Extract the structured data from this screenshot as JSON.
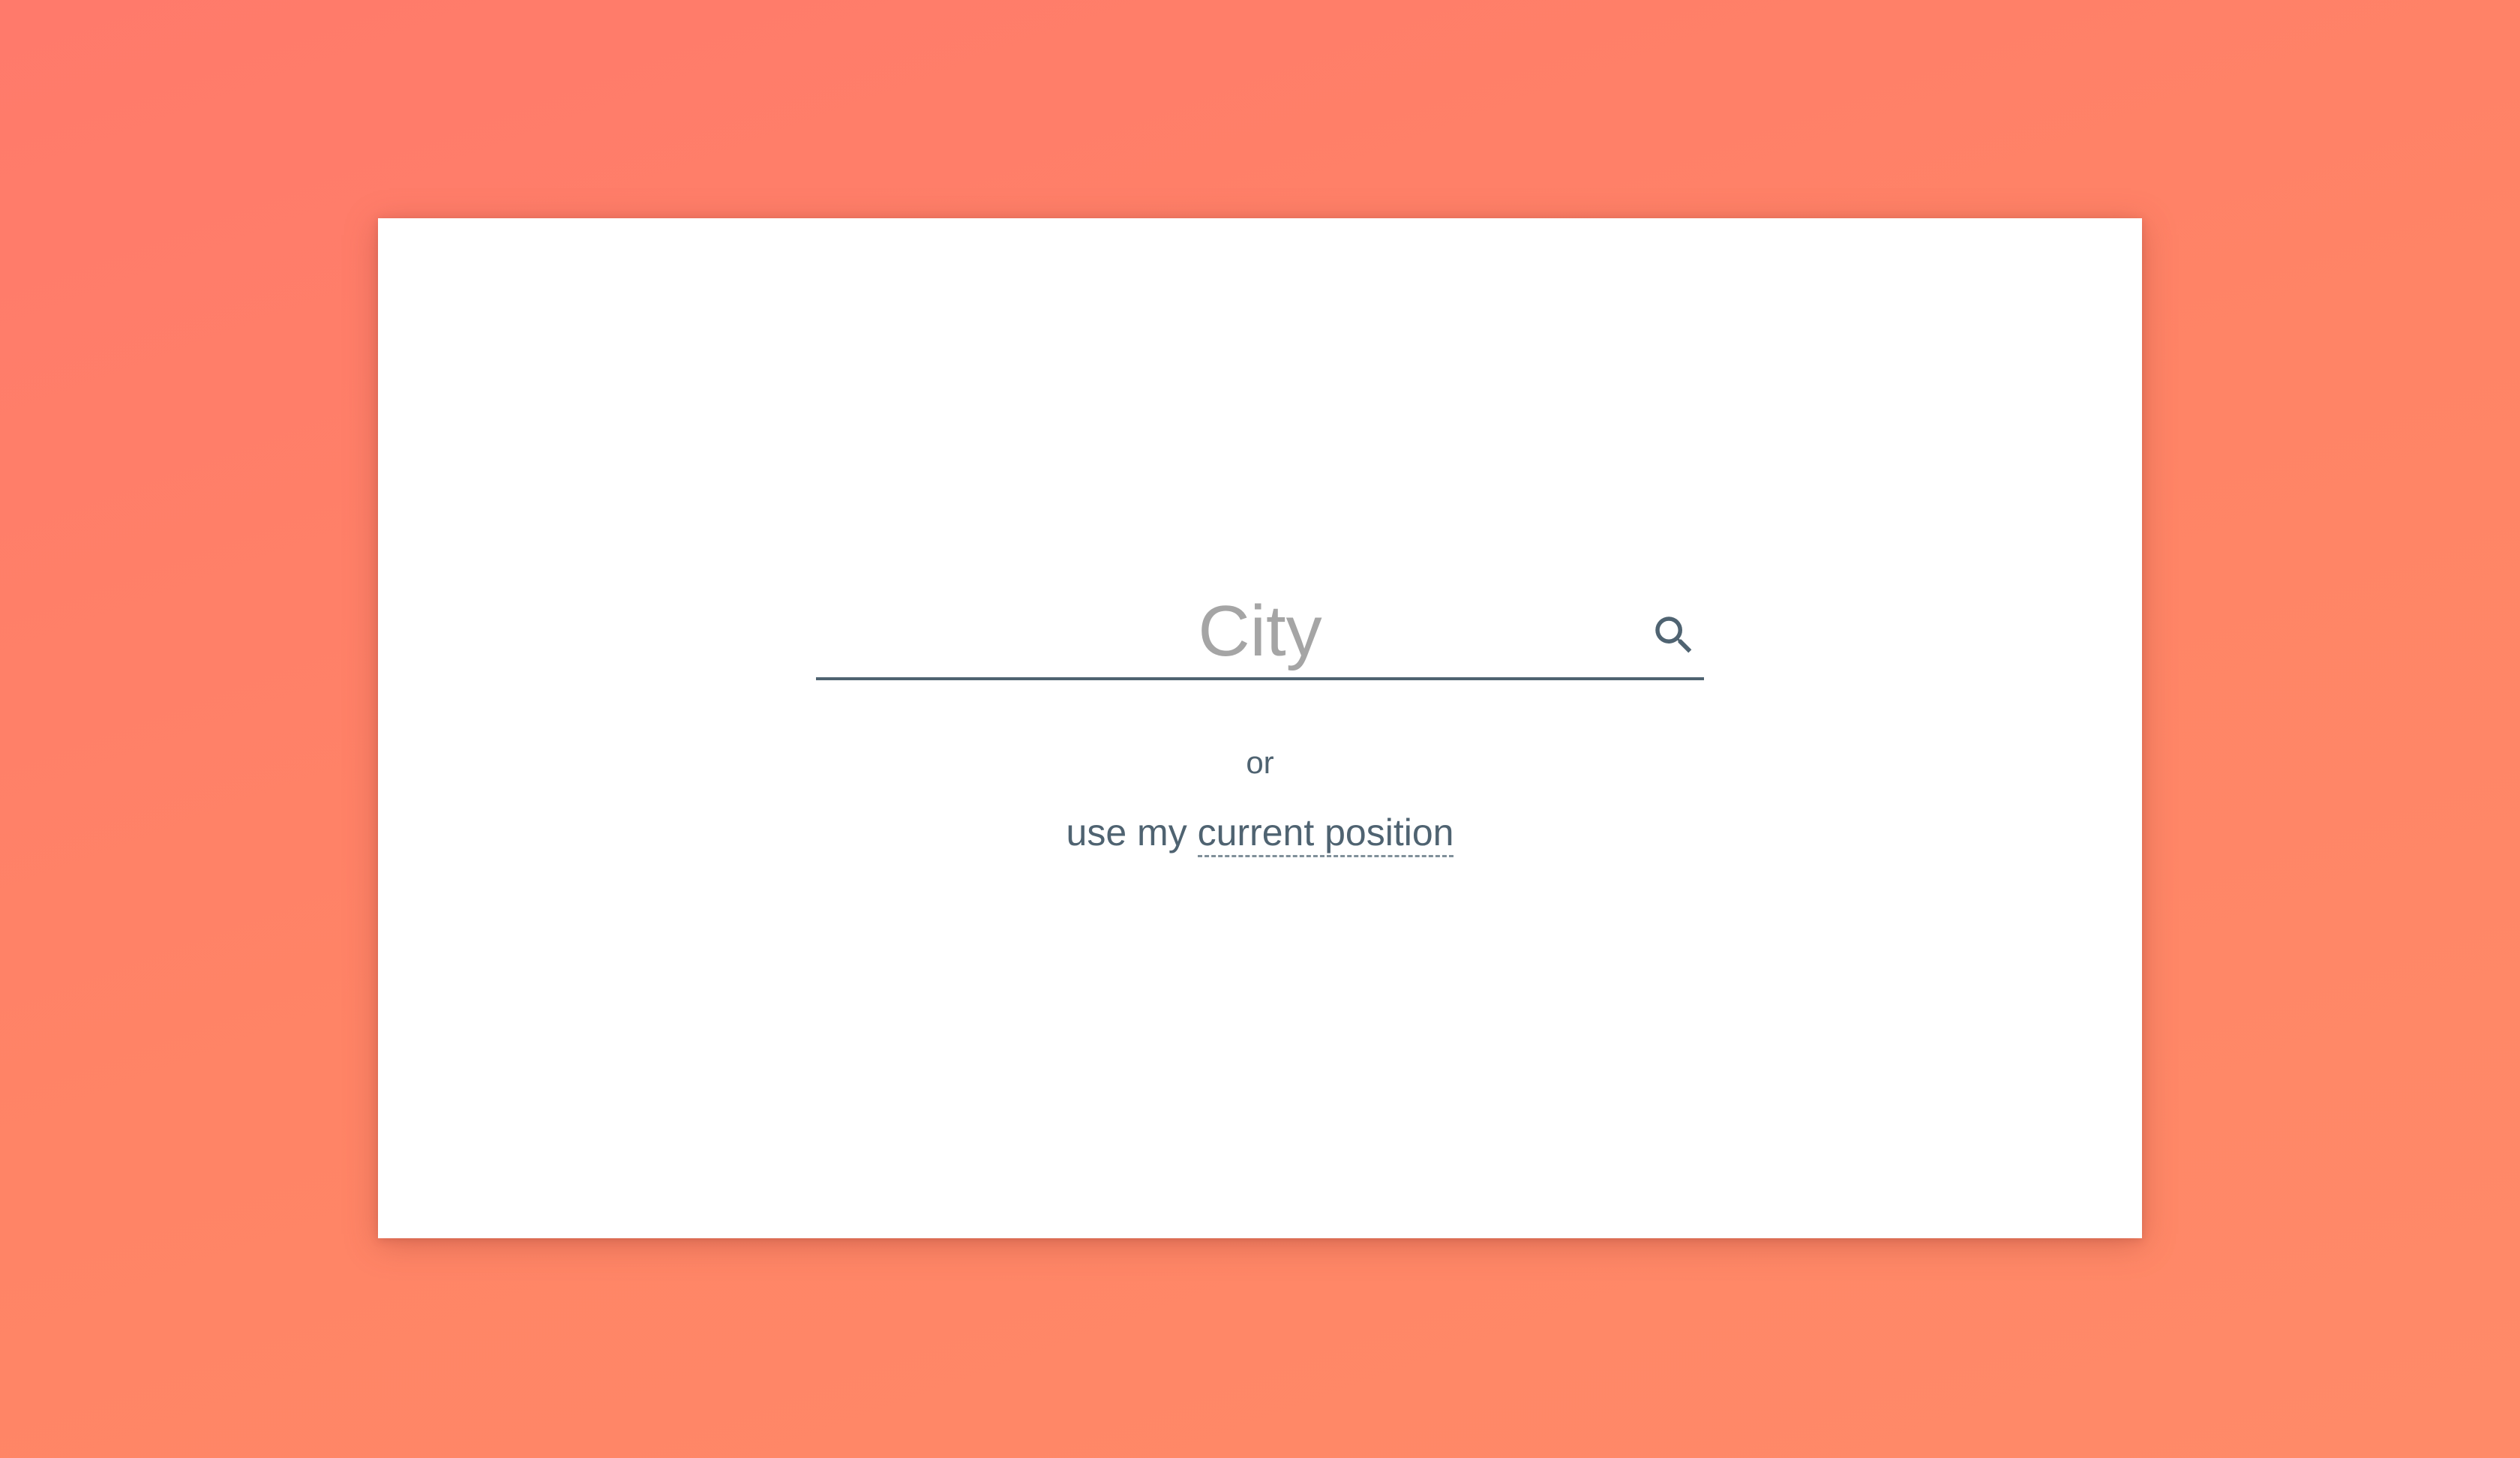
{
  "colors": {
    "background_start": "#ff7a6b",
    "background_end": "#ff8a68",
    "card": "#ffffff",
    "text": "#4f6371",
    "placeholder": "#a5a5a5"
  },
  "search": {
    "placeholder": "City",
    "value": "",
    "icon": "search-icon"
  },
  "separator_text": "or",
  "geolocation": {
    "prefix": "use my ",
    "link_label": "current position"
  }
}
